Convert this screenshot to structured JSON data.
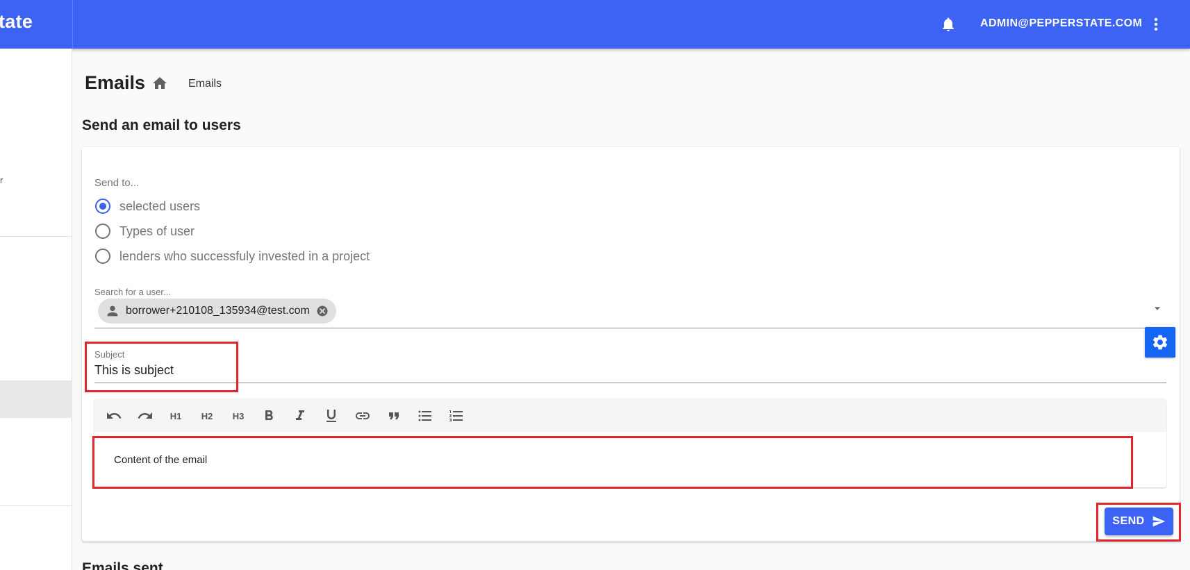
{
  "appbar": {
    "brand": "tate",
    "account": "ADMIN@PEPPERSTATE.COM",
    "bell_icon": "notification-bell-icon",
    "more_icon": "more-vert-icon",
    "color": "#3d63f5"
  },
  "sidebar": {
    "fragment": "r"
  },
  "page": {
    "title": "Emails",
    "breadcrumb": "Emails"
  },
  "form": {
    "section_title": "Send an email to users",
    "send_to_label": "Send to...",
    "send_to_options": [
      {
        "label": "selected users",
        "checked": true
      },
      {
        "label": "Types of user",
        "checked": false
      },
      {
        "label": "lenders who successfuly invested in a project",
        "checked": false
      }
    ],
    "search_label": "Search for a user...",
    "selected_chip": "borrower+210108_135934@test.com",
    "subject_label": "Subject",
    "subject_value": "This is subject",
    "editor": {
      "toolbar": {
        "undo": "undo-icon",
        "redo": "redo-icon",
        "h1": "H1",
        "h2": "H2",
        "h3": "H3",
        "bold": "bold-icon",
        "italic": "italic-icon",
        "underline": "underline-icon",
        "link": "link-icon",
        "quote": "quote-icon",
        "bullet_list": "bullet-list-icon",
        "ordered_list": "ordered-list-icon"
      },
      "content": "Content of the email"
    },
    "send_label": "SEND"
  },
  "sent_section": {
    "title": "Emails sent"
  },
  "colors": {
    "primary": "#3d63f5",
    "highlight": "#e3262c",
    "fab": "#1565f5"
  }
}
